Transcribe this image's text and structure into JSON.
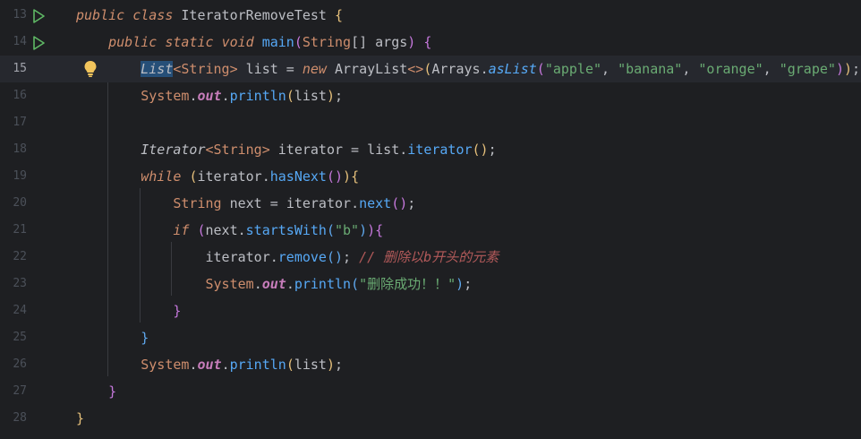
{
  "editor": {
    "line_numbers": [
      "13",
      "14",
      "15",
      "16",
      "17",
      "18",
      "19",
      "20",
      "21",
      "22",
      "23",
      "24",
      "25",
      "26",
      "27",
      "28"
    ],
    "current_line": "15",
    "tokens": {
      "public": "public",
      "class": "class",
      "static": "static",
      "void": "void",
      "new": "new",
      "while": "while",
      "if": "if",
      "class_name": "IteratorRemoveTest",
      "main": "main",
      "String": "String",
      "args": "args",
      "List": "List",
      "list": "list",
      "ArrayList": "ArrayList",
      "Arrays": "Arrays",
      "asList": "asList",
      "s_apple": "\"apple\"",
      "s_banana": "\"banana\"",
      "s_orange": "\"orange\"",
      "s_grape": "\"grape\"",
      "System": "System",
      "out": "out",
      "println": "println",
      "Iterator": "Iterator",
      "iterator": "iterator",
      "iterator_call": "iterator",
      "hasNext": "hasNext",
      "next_var": "next",
      "next_call": "next",
      "startsWith": "startsWith",
      "s_b": "\"b\"",
      "remove": "remove",
      "comment": "// 删除以b开头的元素",
      "s_success": "\"删除成功！！\""
    }
  }
}
